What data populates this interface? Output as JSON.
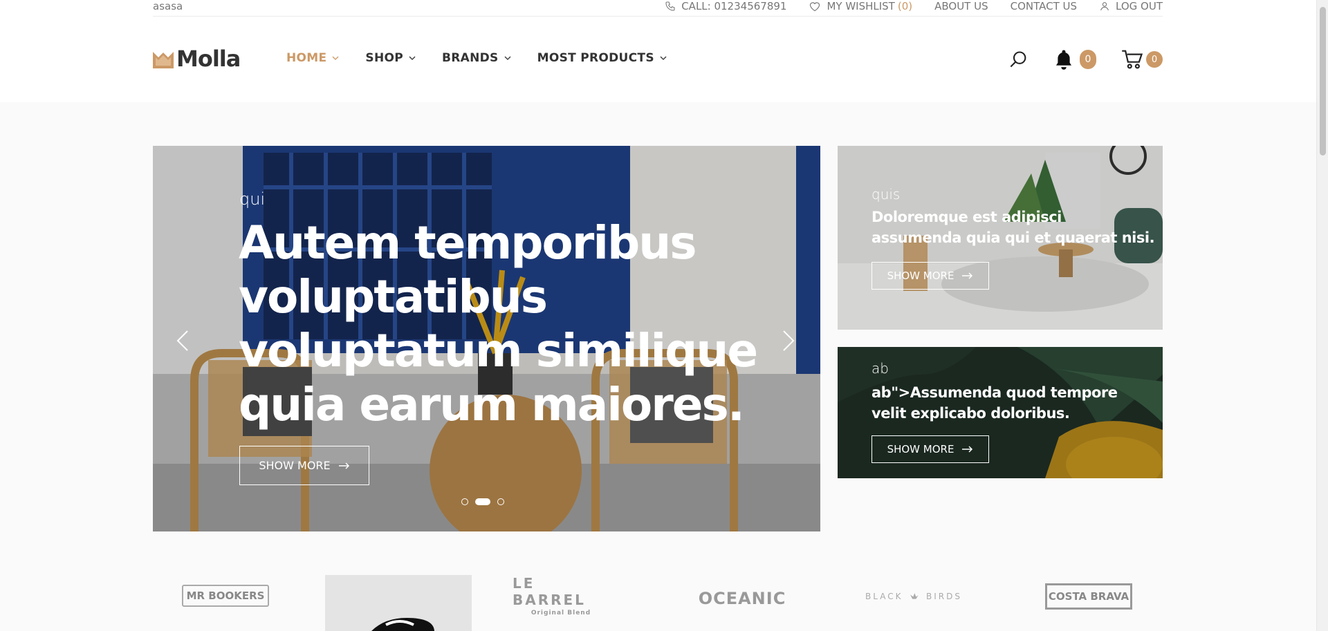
{
  "topbar": {
    "user_text": "asasa",
    "call": "CALL: 01234567891",
    "wishlist_label": "MY WISHLIST",
    "wishlist_count": "(0)",
    "about": "ABOUT US",
    "contact": "CONTACT US",
    "logout": "LOG OUT"
  },
  "brand": {
    "name": "Molla",
    "accent": "#cc9966"
  },
  "nav": {
    "items": [
      {
        "label": "HOME",
        "active": true
      },
      {
        "label": "SHOP",
        "active": false
      },
      {
        "label": "BRANDS",
        "active": false
      },
      {
        "label": "MOST PRODUCTS",
        "active": false
      }
    ]
  },
  "header_icons": {
    "search": "search-icon",
    "notifications_count": "0",
    "cart_count": "0"
  },
  "hero": {
    "subtitle": "qui",
    "title": "Autem temporibus voluptatibus voluptatum similique quia earum maiores.",
    "button": "SHOW MORE",
    "slides": 3,
    "active_slide": 2
  },
  "banners": [
    {
      "subtitle": "quis",
      "title": "Doloremque est adipisci assumenda quia qui et quaerat nisi.",
      "button": "SHOW MORE"
    },
    {
      "subtitle": "ab",
      "title": "ab\">Assumenda quod tempore velit explicabo doloribus.",
      "button": "SHOW MORE"
    }
  ],
  "brands": {
    "logos": [
      "MR BOOKERS",
      "LE BARREL",
      "Original Blend",
      "OCEANIC",
      "BLACK",
      "BIRDS",
      "COSTA BRAVA"
    ]
  }
}
